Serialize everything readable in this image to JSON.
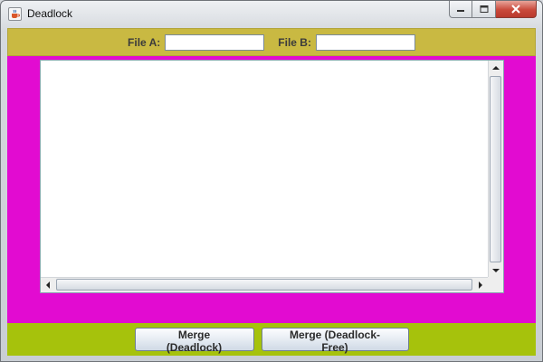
{
  "window": {
    "title": "Deadlock",
    "app_icon": "java-cup-icon",
    "controls": [
      "minimize-icon",
      "maximize-icon",
      "close-icon"
    ]
  },
  "file_inputs": {
    "file_a_label": "File A:",
    "file_a_value": "",
    "file_b_label": "File B:",
    "file_b_value": ""
  },
  "output": {
    "text": ""
  },
  "buttons": {
    "merge_deadlock": "Merge (Deadlock)",
    "merge_deadlock_free": "Merge (Deadlock-Free)"
  },
  "colors": {
    "top_panel": "#c9b942",
    "center_panel": "#e20bd1",
    "bottom_panel": "#a6c20c"
  }
}
